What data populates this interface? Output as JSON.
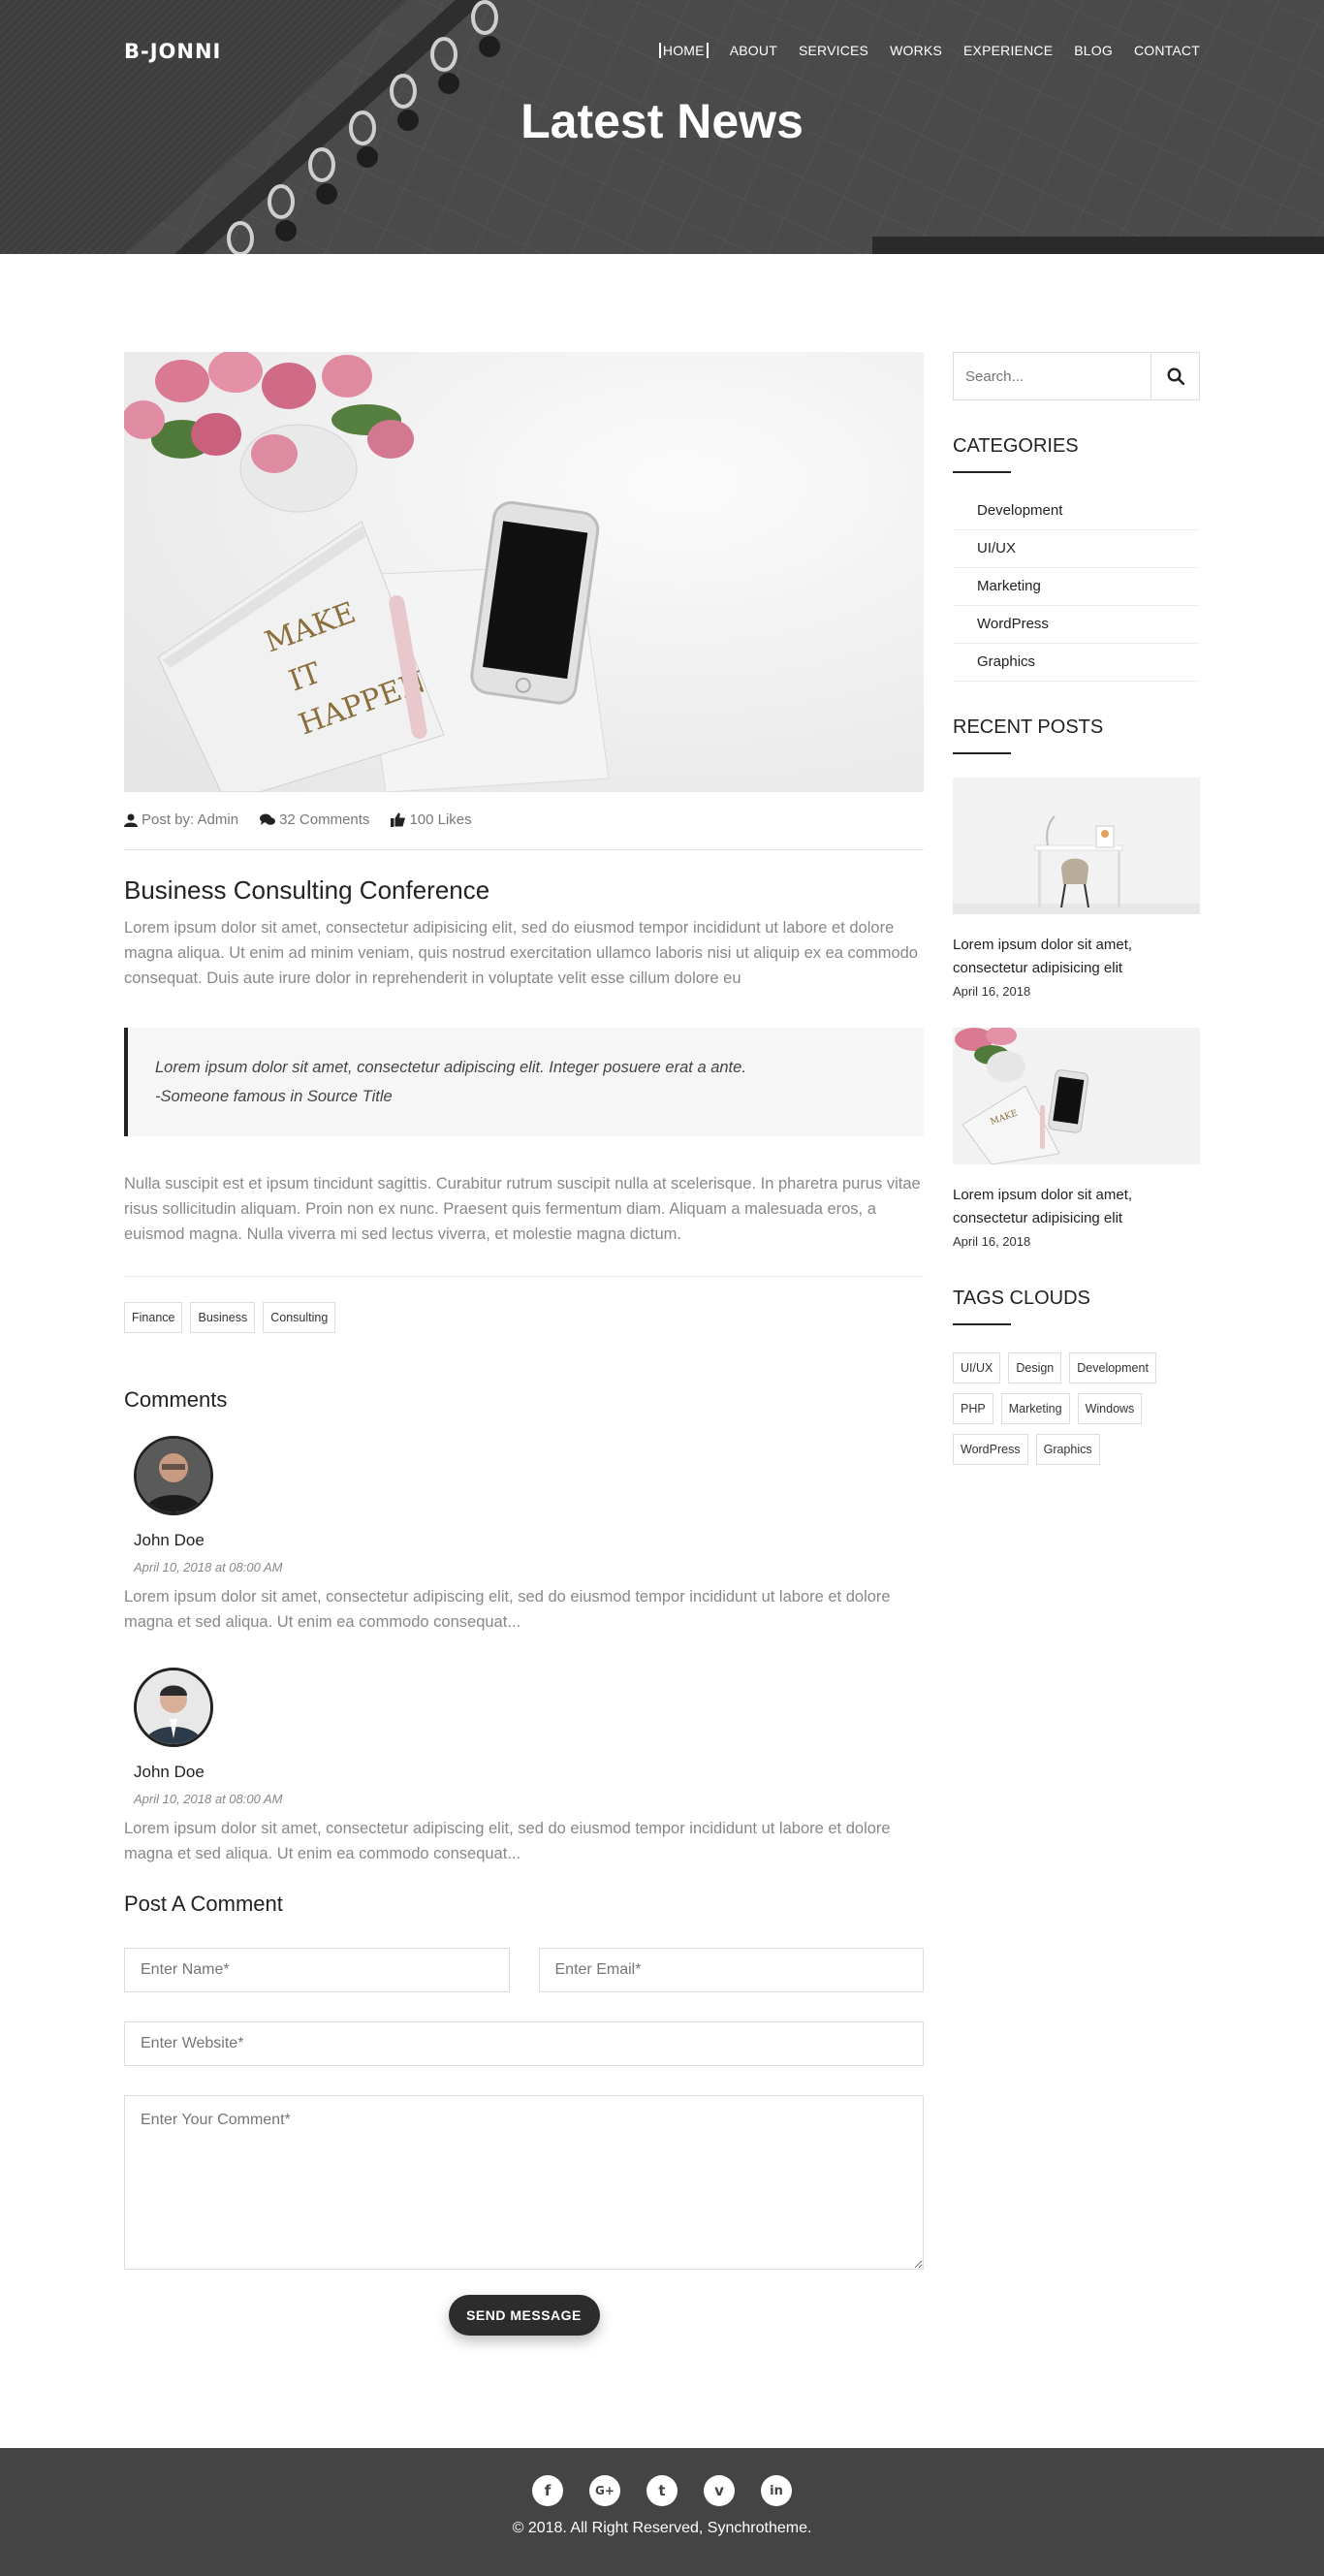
{
  "brand": {
    "logo": "B-JONNI"
  },
  "nav": {
    "items": [
      {
        "label": "HOME"
      },
      {
        "label": "ABOUT"
      },
      {
        "label": "SERVICES"
      },
      {
        "label": "WORKS"
      },
      {
        "label": "EXPERIENCE"
      },
      {
        "label": "BLOG"
      },
      {
        "label": "CONTACT"
      }
    ]
  },
  "hero": {
    "title": "Latest News"
  },
  "post": {
    "meta": {
      "author": "Post by: Admin",
      "comments": "32 Comments",
      "likes": "100 Likes"
    },
    "title": "Business Consulting Conference",
    "paragraph1": "Lorem ipsum dolor sit amet, consectetur adipisicing elit, sed do eiusmod tempor incididunt ut labore et dolore magna aliqua. Ut enim ad minim veniam, quis nostrud exercitation ullamco laboris nisi ut aliquip ex ea commodo consequat. Duis aute irure dolor in reprehenderit in voluptate velit esse cillum dolore eu",
    "quote_line1": "Lorem ipsum dolor sit amet, consectetur adipiscing elit. Integer posuere erat a ante.",
    "quote_line2": "-Someone famous in Source Title",
    "paragraph2": "Nulla suscipit est et ipsum tincidunt sagittis. Curabitur rutrum suscipit nulla at scelerisque. In pharetra purus vitae risus sollicitudin aliquam. Proin non ex nunc. Praesent quis fermentum diam. Aliquam a malesuada eros, a euismod magna. Nulla viverra mi sed lectus viverra, et molestie magna dictum.",
    "tags": [
      "Finance",
      "Business",
      "Consulting"
    ],
    "image_text": [
      "MAKE",
      "IT",
      "HAPPEN"
    ]
  },
  "comments": {
    "title": "Comments",
    "items": [
      {
        "name": "John Doe",
        "date": "April 10, 2018 at 08:00 AM",
        "text": "Lorem ipsum dolor sit amet, consectetur adipiscing elit, sed do eiusmod tempor incididunt ut labore et dolore magna et sed aliqua. Ut enim ea commodo consequat..."
      },
      {
        "name": "John Doe",
        "date": "April 10, 2018 at 08:00 AM",
        "text": "Lorem ipsum dolor sit amet, consectetur adipiscing elit, sed do eiusmod tempor incididunt ut labore et dolore magna et sed aliqua. Ut enim ea commodo consequat..."
      }
    ]
  },
  "form": {
    "title": "Post A Comment",
    "name_placeholder": "Enter Name*",
    "email_placeholder": "Enter Email*",
    "website_placeholder": "Enter Website*",
    "comment_placeholder": "Enter Your Comment*",
    "submit_label": "SEND MESSAGE"
  },
  "sidebar": {
    "search_placeholder": "Search...",
    "categories_title": "CATEGORIES",
    "categories": [
      "Development",
      "UI/UX",
      "Marketing",
      "WordPress",
      "Graphics"
    ],
    "recent_title": "RECENT POSTS",
    "recent": [
      {
        "title": "Lorem ipsum dolor sit amet, consectetur adipisicing elit",
        "date": "April 16, 2018"
      },
      {
        "title": "Lorem ipsum dolor sit amet, consectetur adipisicing elit",
        "date": "April 16, 2018"
      }
    ],
    "tags_title": "TAGS CLOUDS",
    "tags": [
      "UI/UX",
      "Design",
      "Development",
      "PHP",
      "Marketing",
      "Windows",
      "WordPress",
      "Graphics"
    ]
  },
  "footer": {
    "socials": [
      {
        "icon": "facebook-icon",
        "glyph": "f"
      },
      {
        "icon": "google-plus-icon",
        "glyph": "G+"
      },
      {
        "icon": "twitter-icon",
        "glyph": "t"
      },
      {
        "icon": "vimeo-icon",
        "glyph": "v"
      },
      {
        "icon": "linkedin-icon",
        "glyph": "in"
      }
    ],
    "copyright": "© 2018. All Right Reserved, Synchrotheme."
  },
  "colors": {
    "accent": "#222222",
    "footer_bg": "#444444",
    "hero_bg": "#4a4a4a"
  }
}
